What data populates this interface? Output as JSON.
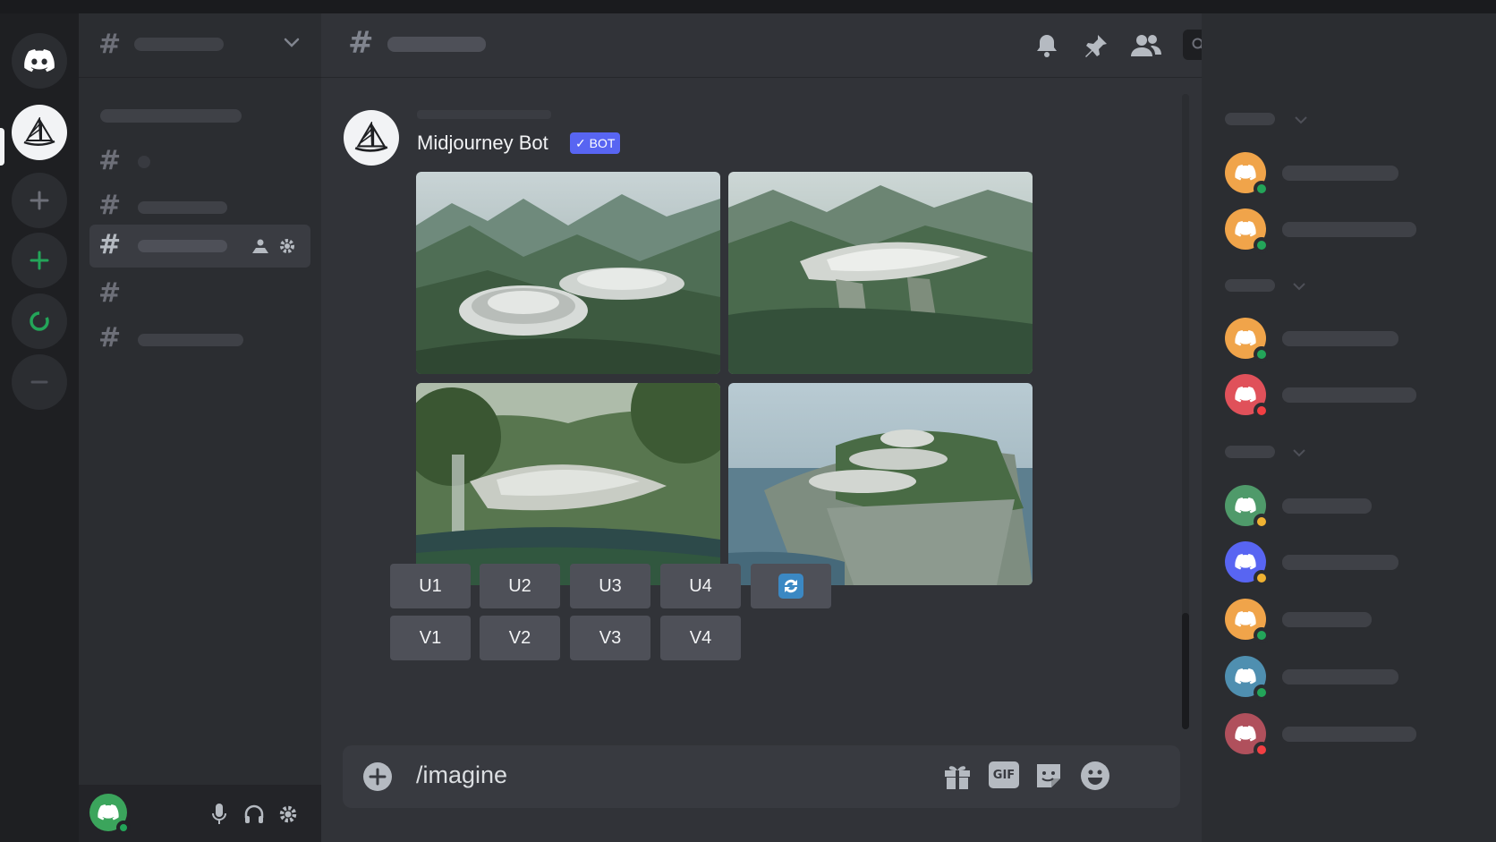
{
  "message": {
    "author": "Midjourney Bot",
    "bot_tag": "BOT",
    "upscale_buttons": [
      "U1",
      "U2",
      "U3",
      "U4"
    ],
    "variation_buttons": [
      "V1",
      "V2",
      "V3",
      "V4"
    ]
  },
  "composer": {
    "value": "/imagine",
    "gif_label": "GIF"
  },
  "colors": {
    "blurple": "#5865f2",
    "online": "#23a559",
    "idle": "#f0b232",
    "dnd": "#f23f43",
    "avatar_orange": "#f0a44a",
    "avatar_red": "#e0515a",
    "avatar_green": "#4f9a6a",
    "avatar_blue": "#5865f2",
    "avatar_teal": "#4f8fb0",
    "avatar_pink": "#b0505c"
  },
  "icons": [
    "discord-icon",
    "midjourney-sail-icon",
    "plus-icon",
    "compass-icon",
    "bell-icon",
    "pin-icon",
    "members-icon",
    "search-icon",
    "inbox-icon",
    "help-icon",
    "gift-icon",
    "gif-icon",
    "sticker-icon",
    "emoji-icon",
    "mic-icon",
    "headphones-icon",
    "settings-gear-icon",
    "refresh-icon"
  ]
}
